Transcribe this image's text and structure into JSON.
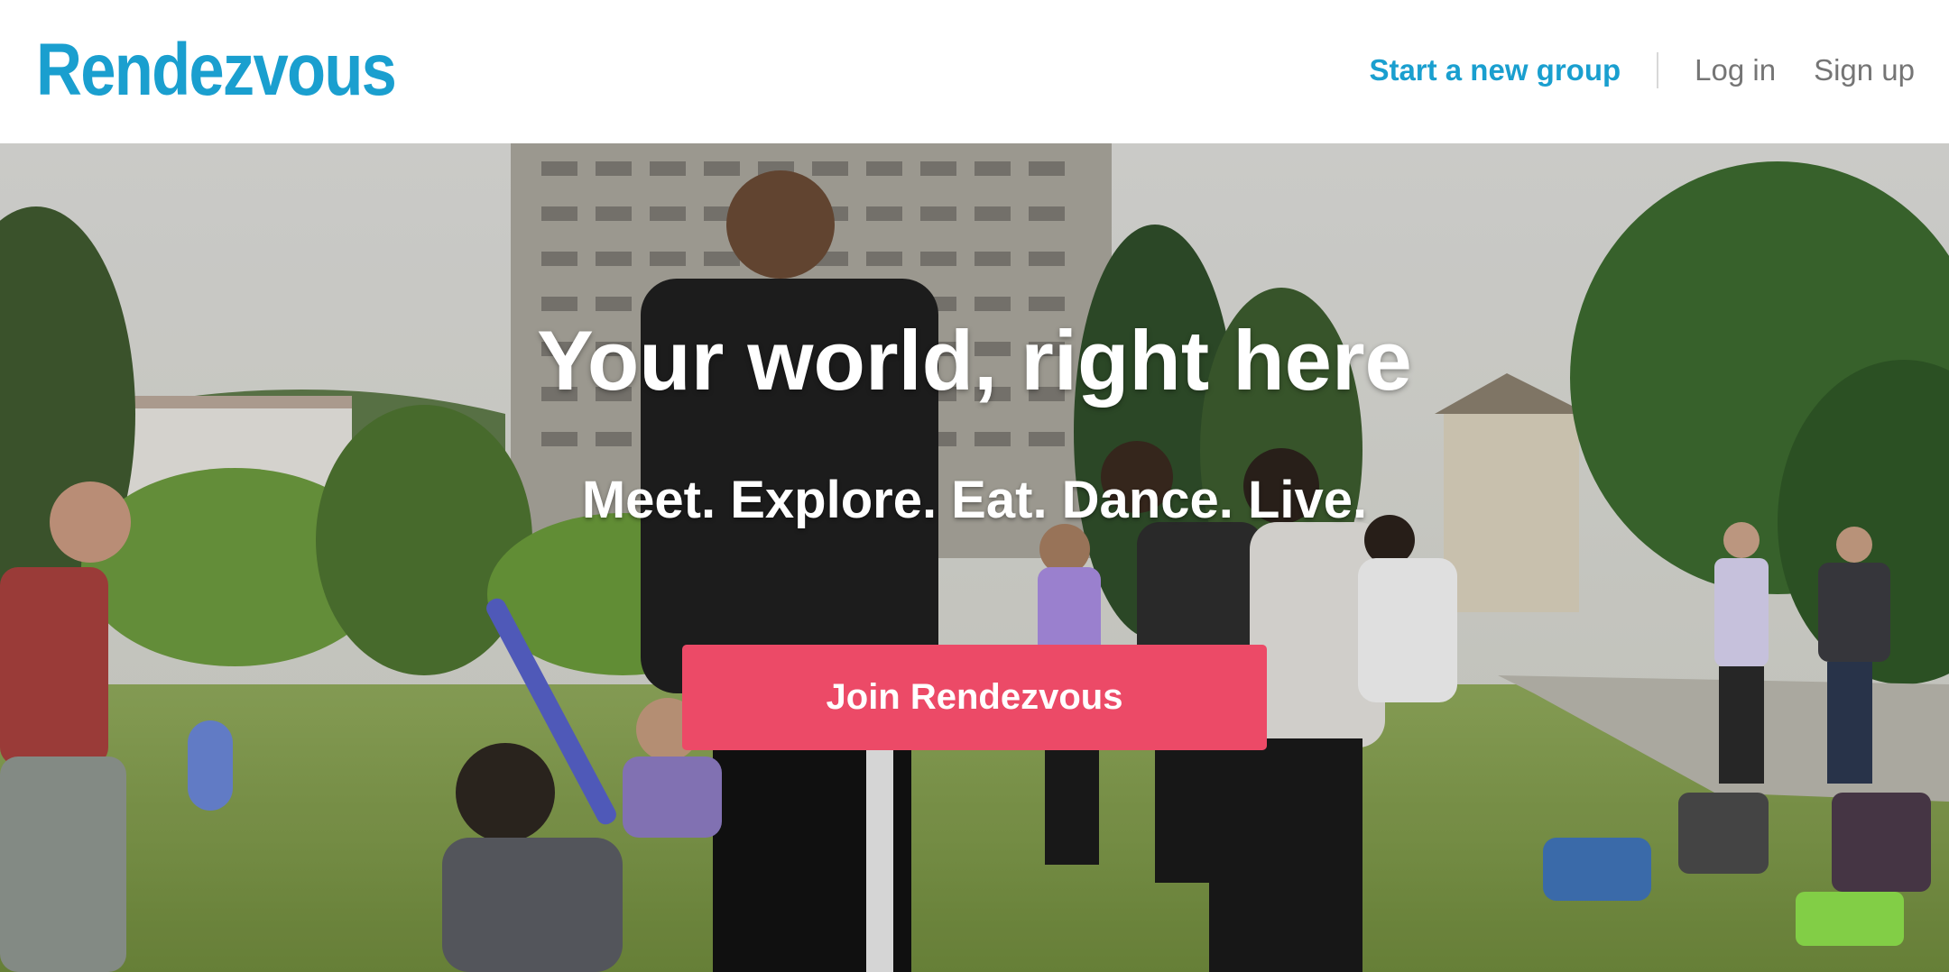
{
  "header": {
    "logo_text": "Rendezvous",
    "nav": {
      "start_group_label": "Start a new group",
      "login_label": "Log in",
      "signup_label": "Sign up"
    }
  },
  "hero": {
    "title": "Your world, right here",
    "subtitle": "Meet. Explore. Eat. Dance. Live.",
    "cta_label": "Join Rendezvous",
    "background_image": "people playing on a grass lawn in front of a tall concrete building"
  },
  "colors": {
    "brand": "#1a9fcf",
    "cta": "#ec4a67",
    "nav_muted": "#757575"
  }
}
